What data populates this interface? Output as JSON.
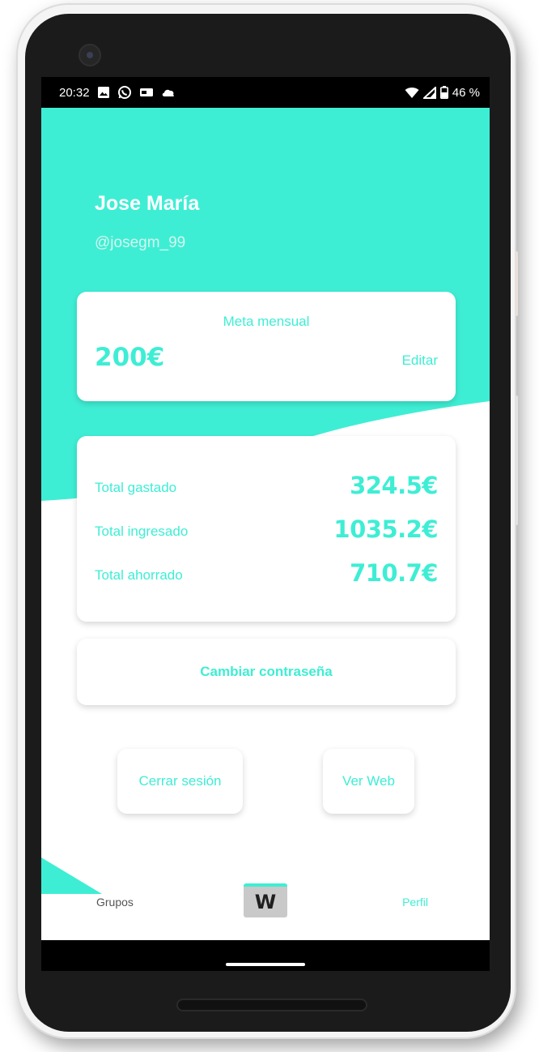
{
  "status_bar": {
    "time": "20:32",
    "battery": "46 %",
    "left_icons": [
      "image-icon",
      "whatsapp-icon",
      "card-icon",
      "cloud-icon"
    ],
    "right_icons": [
      "wifi-icon",
      "signal-icon",
      "battery-icon"
    ]
  },
  "profile": {
    "name": "Jose María",
    "handle": "@josegm_99"
  },
  "goal": {
    "title": "Meta mensual",
    "amount": "200€",
    "edit_label": "Editar"
  },
  "totals": [
    {
      "label": "Total gastado",
      "value": "324.5€"
    },
    {
      "label": "Total ingresado",
      "value": "1035.2€"
    },
    {
      "label": "Total ahorrado",
      "value": "710.7€"
    }
  ],
  "actions": {
    "change_password": "Cambiar contraseña",
    "logout": "Cerrar sesión",
    "view_web": "Ver Web"
  },
  "nav": {
    "groups": "Grupos",
    "logo": "W",
    "profile": "Perfil"
  },
  "colors": {
    "accent": "#3eeed4",
    "frame": "#1b1b1b",
    "status_bar": "#000000"
  }
}
